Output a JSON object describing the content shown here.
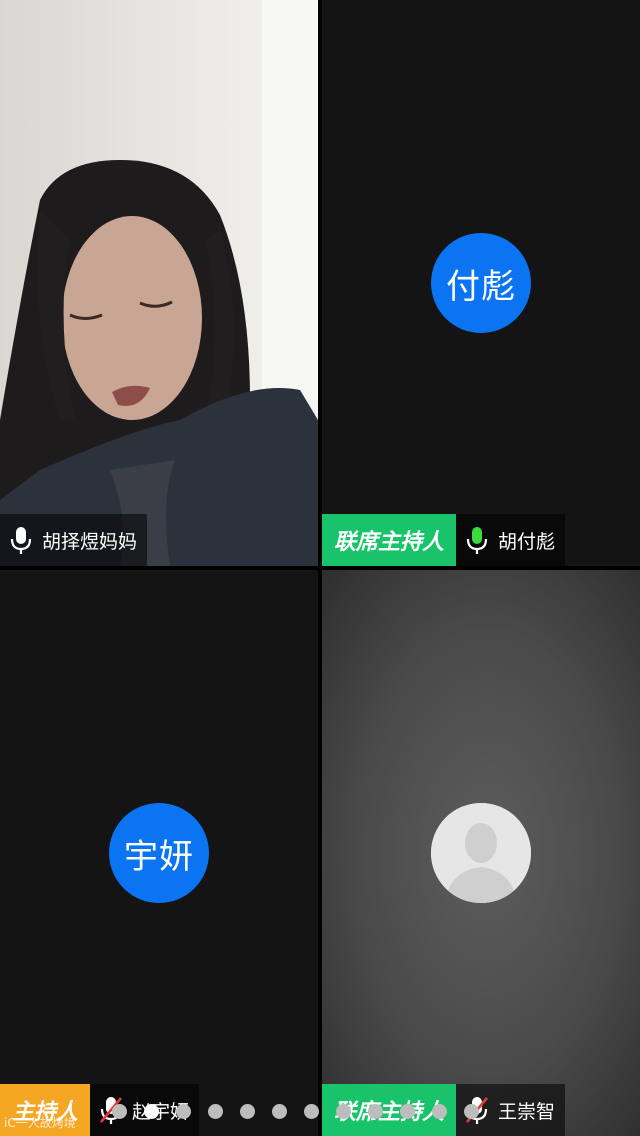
{
  "tiles": [
    {
      "name": "胡择煜妈妈",
      "role": "",
      "mic": "on",
      "view": "camera"
    },
    {
      "name": "胡付彪",
      "role": "联席主持人",
      "mic": "on",
      "avatar_text": "付彪",
      "view": "avatar"
    },
    {
      "name": "赵宇妍",
      "role": "主持人",
      "mic": "muted",
      "avatar_text": "宇妍",
      "view": "avatar"
    },
    {
      "name": "王崇智",
      "role": "联席主持人",
      "mic": "muted",
      "view": "default-avatar"
    }
  ],
  "pager": {
    "page_count": 12,
    "active_index": 1
  },
  "watermark": "iC一人故烤境",
  "colors": {
    "avatar_blue": "#0a74f2",
    "cohost_green": "#19c36a",
    "host_orange": "#f5a623",
    "mic_on_green": "#3ddc3d",
    "mic_muted_red": "#e53935"
  }
}
